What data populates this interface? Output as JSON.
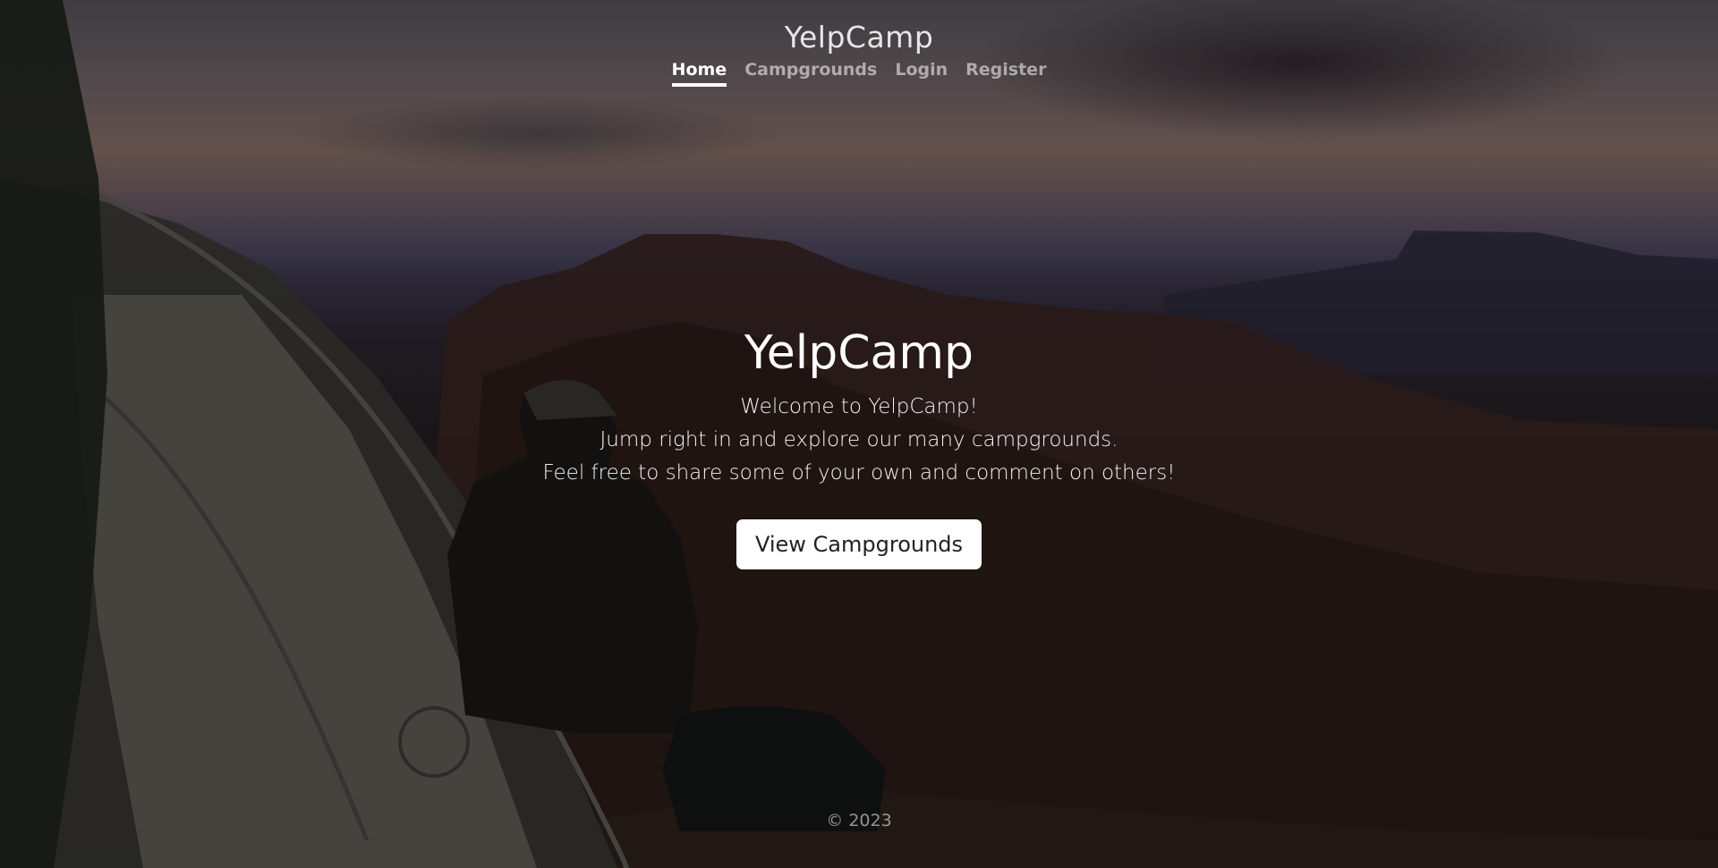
{
  "header": {
    "brand": "YelpCamp",
    "nav": [
      {
        "label": "Home",
        "active": true
      },
      {
        "label": "Campgrounds",
        "active": false
      },
      {
        "label": "Login",
        "active": false
      },
      {
        "label": "Register",
        "active": false
      }
    ]
  },
  "hero": {
    "title": "YelpCamp",
    "lines": [
      "Welcome to YelpCamp!",
      "Jump right in and explore our many campgrounds.",
      "Feel free to share some of your own and comment on others!"
    ],
    "button_label": "View Campgrounds"
  },
  "footer": {
    "text": "© 2023"
  },
  "colors": {
    "text": "#ffffff",
    "button_bg": "#ffffff",
    "button_text": "#222222"
  }
}
